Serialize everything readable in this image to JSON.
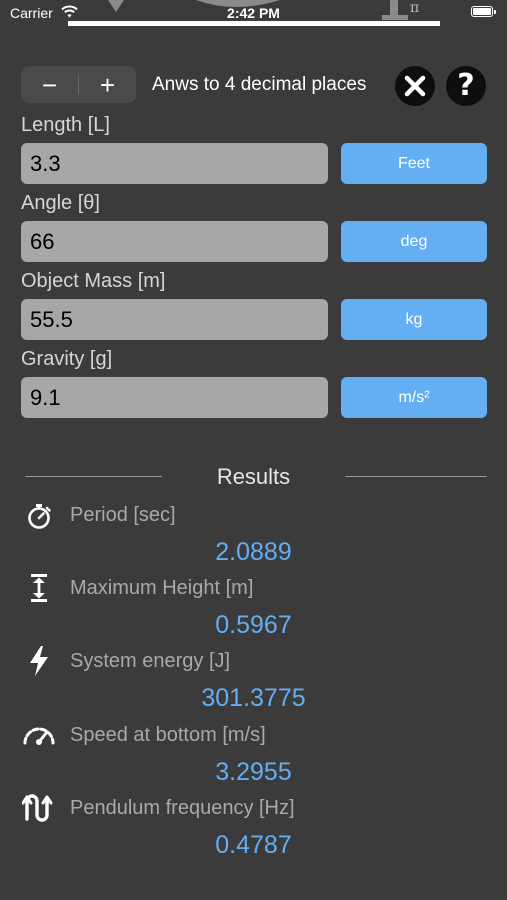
{
  "status": {
    "carrier": "Carrier",
    "time": "2:42 PM"
  },
  "toolbar": {
    "minus_label": "−",
    "plus_label": "+",
    "precision_text": "Anws to 4 decimal places",
    "help_label": "?"
  },
  "inputs": [
    {
      "label": "Length [L]",
      "value": "3.3",
      "unit": "Feet"
    },
    {
      "label": "Angle [θ]",
      "value": "66",
      "unit": "deg"
    },
    {
      "label": "Object Mass [m]",
      "value": "55.5",
      "unit": "kg"
    },
    {
      "label": "Gravity [g]",
      "value": "9.1",
      "unit": "m/s²"
    }
  ],
  "results": {
    "title": "Results",
    "items": [
      {
        "label": "Period [sec]",
        "value": "2.0889",
        "icon": "stopwatch-icon"
      },
      {
        "label": "Maximum Height [m]",
        "value": "0.5967",
        "icon": "height-icon"
      },
      {
        "label": "System energy [J]",
        "value": "301.3775",
        "icon": "lightning-icon"
      },
      {
        "label": "Speed at bottom [m/s]",
        "value": "3.2955",
        "icon": "speedometer-icon"
      },
      {
        "label": "Pendulum frequency [Hz]",
        "value": "0.4787",
        "icon": "wave-icon"
      }
    ]
  },
  "colors": {
    "background": "#3b3b3b",
    "accent": "#64aef3",
    "result_value": "#63adf2",
    "input_bg": "#a7a7a7"
  }
}
